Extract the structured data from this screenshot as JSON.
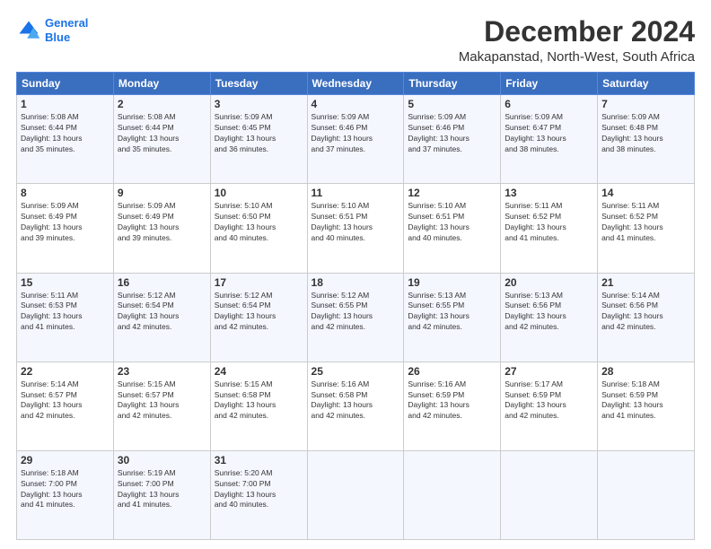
{
  "header": {
    "logo_line1": "General",
    "logo_line2": "Blue",
    "title": "December 2024",
    "subtitle": "Makapanstad, North-West, South Africa"
  },
  "weekdays": [
    "Sunday",
    "Monday",
    "Tuesday",
    "Wednesday",
    "Thursday",
    "Friday",
    "Saturday"
  ],
  "weeks": [
    [
      {
        "day": "1",
        "info": "Sunrise: 5:08 AM\nSunset: 6:44 PM\nDaylight: 13 hours\nand 35 minutes."
      },
      {
        "day": "2",
        "info": "Sunrise: 5:08 AM\nSunset: 6:44 PM\nDaylight: 13 hours\nand 35 minutes."
      },
      {
        "day": "3",
        "info": "Sunrise: 5:09 AM\nSunset: 6:45 PM\nDaylight: 13 hours\nand 36 minutes."
      },
      {
        "day": "4",
        "info": "Sunrise: 5:09 AM\nSunset: 6:46 PM\nDaylight: 13 hours\nand 37 minutes."
      },
      {
        "day": "5",
        "info": "Sunrise: 5:09 AM\nSunset: 6:46 PM\nDaylight: 13 hours\nand 37 minutes."
      },
      {
        "day": "6",
        "info": "Sunrise: 5:09 AM\nSunset: 6:47 PM\nDaylight: 13 hours\nand 38 minutes."
      },
      {
        "day": "7",
        "info": "Sunrise: 5:09 AM\nSunset: 6:48 PM\nDaylight: 13 hours\nand 38 minutes."
      }
    ],
    [
      {
        "day": "8",
        "info": "Sunrise: 5:09 AM\nSunset: 6:49 PM\nDaylight: 13 hours\nand 39 minutes."
      },
      {
        "day": "9",
        "info": "Sunrise: 5:09 AM\nSunset: 6:49 PM\nDaylight: 13 hours\nand 39 minutes."
      },
      {
        "day": "10",
        "info": "Sunrise: 5:10 AM\nSunset: 6:50 PM\nDaylight: 13 hours\nand 40 minutes."
      },
      {
        "day": "11",
        "info": "Sunrise: 5:10 AM\nSunset: 6:51 PM\nDaylight: 13 hours\nand 40 minutes."
      },
      {
        "day": "12",
        "info": "Sunrise: 5:10 AM\nSunset: 6:51 PM\nDaylight: 13 hours\nand 40 minutes."
      },
      {
        "day": "13",
        "info": "Sunrise: 5:11 AM\nSunset: 6:52 PM\nDaylight: 13 hours\nand 41 minutes."
      },
      {
        "day": "14",
        "info": "Sunrise: 5:11 AM\nSunset: 6:52 PM\nDaylight: 13 hours\nand 41 minutes."
      }
    ],
    [
      {
        "day": "15",
        "info": "Sunrise: 5:11 AM\nSunset: 6:53 PM\nDaylight: 13 hours\nand 41 minutes."
      },
      {
        "day": "16",
        "info": "Sunrise: 5:12 AM\nSunset: 6:54 PM\nDaylight: 13 hours\nand 42 minutes."
      },
      {
        "day": "17",
        "info": "Sunrise: 5:12 AM\nSunset: 6:54 PM\nDaylight: 13 hours\nand 42 minutes."
      },
      {
        "day": "18",
        "info": "Sunrise: 5:12 AM\nSunset: 6:55 PM\nDaylight: 13 hours\nand 42 minutes."
      },
      {
        "day": "19",
        "info": "Sunrise: 5:13 AM\nSunset: 6:55 PM\nDaylight: 13 hours\nand 42 minutes."
      },
      {
        "day": "20",
        "info": "Sunrise: 5:13 AM\nSunset: 6:56 PM\nDaylight: 13 hours\nand 42 minutes."
      },
      {
        "day": "21",
        "info": "Sunrise: 5:14 AM\nSunset: 6:56 PM\nDaylight: 13 hours\nand 42 minutes."
      }
    ],
    [
      {
        "day": "22",
        "info": "Sunrise: 5:14 AM\nSunset: 6:57 PM\nDaylight: 13 hours\nand 42 minutes."
      },
      {
        "day": "23",
        "info": "Sunrise: 5:15 AM\nSunset: 6:57 PM\nDaylight: 13 hours\nand 42 minutes."
      },
      {
        "day": "24",
        "info": "Sunrise: 5:15 AM\nSunset: 6:58 PM\nDaylight: 13 hours\nand 42 minutes."
      },
      {
        "day": "25",
        "info": "Sunrise: 5:16 AM\nSunset: 6:58 PM\nDaylight: 13 hours\nand 42 minutes."
      },
      {
        "day": "26",
        "info": "Sunrise: 5:16 AM\nSunset: 6:59 PM\nDaylight: 13 hours\nand 42 minutes."
      },
      {
        "day": "27",
        "info": "Sunrise: 5:17 AM\nSunset: 6:59 PM\nDaylight: 13 hours\nand 42 minutes."
      },
      {
        "day": "28",
        "info": "Sunrise: 5:18 AM\nSunset: 6:59 PM\nDaylight: 13 hours\nand 41 minutes."
      }
    ],
    [
      {
        "day": "29",
        "info": "Sunrise: 5:18 AM\nSunset: 7:00 PM\nDaylight: 13 hours\nand 41 minutes."
      },
      {
        "day": "30",
        "info": "Sunrise: 5:19 AM\nSunset: 7:00 PM\nDaylight: 13 hours\nand 41 minutes."
      },
      {
        "day": "31",
        "info": "Sunrise: 5:20 AM\nSunset: 7:00 PM\nDaylight: 13 hours\nand 40 minutes."
      },
      null,
      null,
      null,
      null
    ]
  ]
}
